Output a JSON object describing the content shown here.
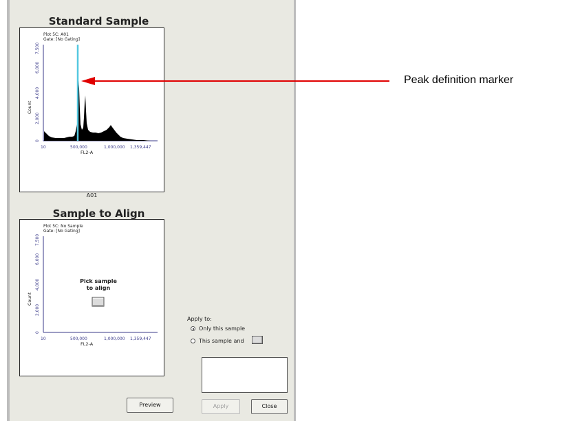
{
  "standard": {
    "title": "Standard Sample",
    "plot_label": "Plot 5C: A01",
    "gate_label": "Gate: [No Gating]",
    "x_label": "FL2-A",
    "y_label": "Count",
    "x_ticks": [
      "10",
      "500,000",
      "1,000,000",
      "1,359,447"
    ],
    "y_ticks": [
      "0",
      "2,000",
      "4,000",
      "6,000",
      "7,500"
    ],
    "caption": "A01"
  },
  "align": {
    "title": "Sample to Align",
    "plot_label": "Plot 5C: No Sample",
    "gate_label": "Gate: [No Gating]",
    "x_label": "FL2-A",
    "y_label": "Count",
    "x_ticks": [
      "10",
      "500,000",
      "1,000,000",
      "1,359,447"
    ],
    "y_ticks": [
      "0",
      "2,000",
      "4,000",
      "6,000",
      "7,500"
    ],
    "pick_line1": "Pick sample",
    "pick_line2": "to align"
  },
  "apply_to": {
    "label": "Apply to:",
    "option_only": "Only this sample",
    "option_and": "This sample and",
    "selected": "option_only"
  },
  "buttons": {
    "preview": "Preview",
    "apply": "Apply",
    "close": "Close"
  },
  "annotation": {
    "text": "Peak definition marker",
    "color": "#e00000"
  },
  "colors": {
    "marker": "#55c8e0",
    "histogram": "#000000",
    "axis": "#3a3a8a"
  }
}
